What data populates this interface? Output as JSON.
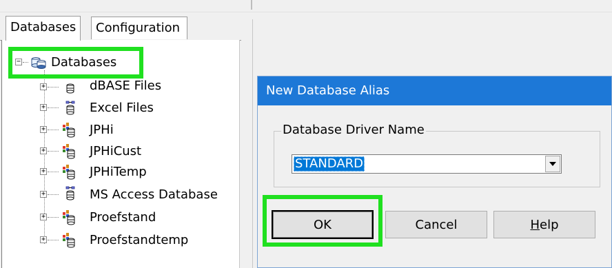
{
  "tabs": {
    "databases": "Databases",
    "configuration": "Configuration"
  },
  "tree": {
    "root": "Databases",
    "items": [
      {
        "label": "dBASE Files",
        "icon": "odbc-db-icon"
      },
      {
        "label": "Excel Files",
        "icon": "odbc-link-db-icon"
      },
      {
        "label": "JPHi",
        "icon": "db-alias-icon"
      },
      {
        "label": "JPHiCust",
        "icon": "db-alias-icon"
      },
      {
        "label": "JPHiTemp",
        "icon": "db-alias-icon"
      },
      {
        "label": "MS Access Database",
        "icon": "odbc-link-db-icon"
      },
      {
        "label": "Proefstand",
        "icon": "db-alias-icon"
      },
      {
        "label": "Proefstandtemp",
        "icon": "db-alias-icon"
      }
    ]
  },
  "dialog": {
    "title": "New Database Alias",
    "group_label": "Database Driver Name",
    "driver_value": "STANDARD",
    "ok_label": "OK",
    "cancel_label": "Cancel",
    "help_label_prefix": "",
    "help_label_underlined": "H",
    "help_label_rest": "elp"
  },
  "colors": {
    "highlight": "#20e020",
    "title_bar": "#1d78d7",
    "selection": "#0078d7"
  }
}
